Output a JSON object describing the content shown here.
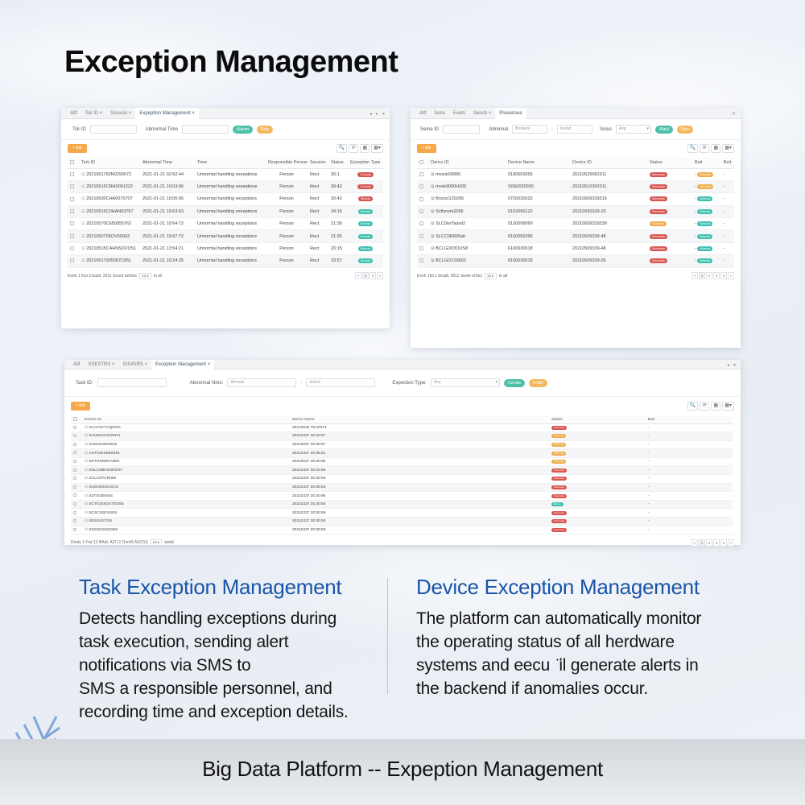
{
  "page": {
    "title": "Exception Management",
    "footer": "Big Data Platform -- Expeption Management"
  },
  "colors": {
    "accent_blue": "#1a55a8",
    "btn_green": "#4cc1a8",
    "btn_orange": "#f4b860",
    "badge_red": "#d9534f",
    "badge_orange": "#f0ad4e",
    "badge_green": "#3cbfae"
  },
  "task_window": {
    "tabs": [
      "Allf",
      "Tsk ID ×",
      "Sosxsio ×",
      "Expeption Management ×"
    ],
    "filters": {
      "task_id_label": "Tsk ID",
      "abnormal_time_label": "Abnormal Time",
      "search_label": "Alalsm",
      "reset_label": "Rsts"
    },
    "add_label": "+ Adr",
    "tools": [
      "🔍",
      "⟳",
      "▦",
      "▦▾"
    ],
    "columns": [
      "Tsrk ID",
      "Abnormal Time",
      "Time",
      "Responsible Person",
      "Session",
      "Status",
      "Exception Type"
    ],
    "rows": [
      {
        "id": "2021051760N0290072",
        "abn": "2021-01-21 02:62:44",
        "desc": "Unnormal handling exeeptions",
        "person": "Person",
        "session": "Rect",
        "status": "30:1",
        "type": "Crounda",
        "type_color": "red"
      },
      {
        "id": "20210515CRH0091222",
        "abn": "2021-01-21 10:03:06",
        "desc": "Unnormal handling exeeptione",
        "person": "Person",
        "session": "Rect",
        "status": "39:42",
        "type": "Crounda",
        "type_color": "red"
      },
      {
        "id": "20210530CHA0070707",
        "abn": "2021-01-21 10:05:06",
        "desc": "Unnormal handling exceptions",
        "person": "Person",
        "session": "Rect",
        "status": "30:42",
        "type": "Blomda",
        "type_color": "red"
      },
      {
        "id": "20210515C0HAN93757",
        "abn": "2021-01-21 10:63:63",
        "desc": "Unnormal handling exeeptions",
        "person": "Person",
        "session": "Rect",
        "status": "34:15",
        "type": "Blomda",
        "type_color": "green"
      },
      {
        "id": "20210570C650055762",
        "abn": "2021-01-21 10:64:72",
        "desc": "Unnormal handling exceptions",
        "person": "Person",
        "session": "Rect",
        "status": "21:38",
        "type": "Blomda",
        "type_color": "green"
      },
      {
        "id": "2021050705OV90063",
        "abn": "2021-01-21 10:67:72",
        "desc": "Unnormal handling exceptions",
        "person": "Person",
        "session": "Rect",
        "status": "21:35",
        "type": "Blomda",
        "type_color": "green"
      },
      {
        "id": "20210515CAHNSOVO51",
        "abn": "2021-01-21 13:54:21",
        "desc": "Unnormal handling exceptions",
        "person": "Person",
        "session": "Rect",
        "status": "20:15",
        "type": "Blomda",
        "type_color": "green"
      },
      {
        "id": "20210517005057C051",
        "abn": "2021-01-21 10:24:25",
        "desc": "Unnormal handling exceptions",
        "person": "Person",
        "session": "Rect",
        "status": "33:57",
        "type": "Blomda",
        "type_color": "green"
      }
    ],
    "pager": {
      "info": "Esnh 1 fnsl 3 bastt. 3011 Seard aetSec",
      "page_size": "12 ▸",
      "suffix": "to all",
      "pages": [
        "<",
        "1",
        "3",
        ">"
      ]
    }
  },
  "device_window": {
    "tabs": [
      "Allf",
      "Sens",
      "Evets",
      "Sensh ×",
      "Presenses"
    ],
    "filters": {
      "device_id_label": "Seme ID",
      "abnormal_label": "Abnomal",
      "start_ph": "Besbeol",
      "end_ph": "Iestsd",
      "status_label": "Solus",
      "status_value": "Avg",
      "search_label": "Alalsl",
      "reset_label": "Rsts"
    },
    "add_label": "+ Adr",
    "tools": [
      "🔍",
      "⟳",
      "▦",
      "▦▾"
    ],
    "columns": [
      "Derics ID",
      "Device Name",
      "Device ID",
      "Status",
      "Boit",
      "Bcit"
    ],
    "rows": [
      {
        "id": "⊙ mvssk09990",
        "name": "0190509359",
        "dev": "20210525092311",
        "status": "Discrunda",
        "status_color": "red",
        "b": "Orounda",
        "b_color": "orange",
        "c": "-"
      },
      {
        "id": "⊙ mvsk9090H205",
        "name": "S0S0020030",
        "dev": "20210510392311",
        "status": "Discrunda",
        "status_color": "red",
        "b": "Oromslia",
        "b_color": "orange",
        "c": "-"
      },
      {
        "id": "⊙ Bnsncl120206",
        "name": "0720020023",
        "dev": "20210609339316",
        "status": "Discrunda",
        "status_color": "red",
        "b": "Blmmda",
        "b_color": "green",
        "c": "-"
      },
      {
        "id": "⊙ Scfisnsm2056",
        "name": "0102090122",
        "dev": "20210930339-23",
        "status": "Discrunda",
        "status_color": "red",
        "b": "Blmmda",
        "b_color": "green",
        "c": "-"
      },
      {
        "id": "⊙ SLC0nsTspsd2",
        "name": "0120099069",
        "dev": "20210609339339",
        "status": "Ouscmda",
        "status_color": "orange",
        "b": "Blmmda",
        "b_color": "green",
        "c": "-"
      },
      {
        "id": "⊙ SLCC0R605ab",
        "name": "6100050395",
        "dev": "20210509339-48",
        "status": "Discrunda",
        "status_color": "red",
        "b": "Blmmda",
        "b_color": "green",
        "c": "-"
      },
      {
        "id": "⊙ BCLGD03OUS8",
        "name": "6100030018",
        "dev": "20210509339-48",
        "status": "Discrunda",
        "status_color": "red",
        "b": "Blmmda",
        "b_color": "green",
        "c": "-"
      },
      {
        "id": "⊙ BCLGD1S5602",
        "name": "6100030018",
        "dev": "20210509339-26",
        "status": "Discrunda",
        "status_color": "red",
        "b": "Blmmda",
        "b_color": "green",
        "c": "-"
      }
    ],
    "pager": {
      "info": "Esnh 1fst 1 beadt. 3011 Seete etSec",
      "page_size": "12 ▸",
      "suffix": "to all",
      "pages": [
        "<",
        "1",
        "2",
        "3",
        "4",
        ">"
      ]
    }
  },
  "exception_window": {
    "tabs": [
      "Allf",
      "SSESTRS ×",
      "SIS4SRS ×",
      "Exception Management ×"
    ],
    "filters": {
      "task_id_label": "Task ID:",
      "abnormal_label": "Abnormal Nmo:",
      "start_ph": "Atnnnal",
      "end_ph": "Iestsd",
      "type_label": "Expection Type:",
      "type_value": "Any",
      "search_label": "Cerdas",
      "reset_label": "Kratls"
    },
    "add_label": "+ Adr",
    "tools": [
      "🔍",
      "⟳",
      "▦",
      "▦▾"
    ],
    "columns": [
      "Device ID",
      "Derics Name",
      "Status",
      "Bsit"
    ],
    "rows": [
      {
        "id": "SLCFSCTCQROS",
        "name": "20210032 T0:20371",
        "status": "Ouscmda",
        "color": "red",
        "b": "-"
      },
      {
        "id": "SAHS5ASSORH4",
        "name": "20210337 30:30:57",
        "status": "Oblmnda",
        "color": "orange",
        "b": "-"
      },
      {
        "id": "SUSNSSEN0S0",
        "name": "20210037 30:30:57",
        "status": "Oblmnda",
        "color": "orange",
        "b": "-"
      },
      {
        "id": "CHTOSISN50S91",
        "name": "20210337 30:35:51",
        "status": "Oblmnda",
        "color": "orange",
        "b": "-"
      },
      {
        "id": "SSTOSSBOA90S",
        "name": "20210637 30:30:95",
        "status": "Oblmnda",
        "color": "orange",
        "b": "-"
      },
      {
        "id": "SSLCSBHSSROS7",
        "name": "20210337 30:33:59",
        "status": "Ouscmda",
        "color": "red",
        "b": "-"
      },
      {
        "id": "SCLCSTCR050",
        "name": "20210337 30:30:93",
        "status": "Ouscmda",
        "color": "red",
        "b": "-"
      },
      {
        "id": "SUSONSSCSCS",
        "name": "20210337 30:30:53",
        "status": "Ouscmda",
        "color": "red",
        "b": "-"
      },
      {
        "id": "S2TISSENSS",
        "name": "20210337 30:30:96",
        "status": "Ouscmda",
        "color": "red",
        "b": "-"
      },
      {
        "id": "SCTIOSSOSTSSS5",
        "name": "20210337 30:30:50",
        "status": "Blmda",
        "color": "green",
        "b": "-"
      },
      {
        "id": "SCSCSSFS0SS",
        "name": "20210337 30:30:59",
        "status": "Ouscmda",
        "color": "red",
        "b": "-"
      },
      {
        "id": "SDSSSSTSS",
        "name": "20210337 30:30:93",
        "status": "Ouscmda",
        "color": "red",
        "b": "-"
      },
      {
        "id": "SSSSSSSSONS",
        "name": "20210337 30:30:59",
        "status": "Ouscmda",
        "color": "red",
        "b": "-"
      }
    ],
    "pager": {
      "info": "Dosts 1 Fsd 13 BAdt. A2I 11 DontS ASCSS",
      "page_size": "10 ▸",
      "suffix": "tardd",
      "pages": [
        "<",
        "1",
        "2",
        "3",
        "4",
        ">"
      ]
    }
  },
  "left_section": {
    "heading": "Task Exception Management",
    "lines": [
      "Detects handling exceptions during",
      "task execution, sending alert",
      "notifications via SMS to",
      "SMS a responsible personnel, and",
      "recording time and exception details."
    ]
  },
  "right_section": {
    "heading": "Device Exception Management",
    "lines": [
      "The platform can automatically monitor",
      "the operating status of all herdware",
      "systems and eecu ‌ ̈il generate alerts in",
      "the backend if anomalies occur."
    ]
  }
}
